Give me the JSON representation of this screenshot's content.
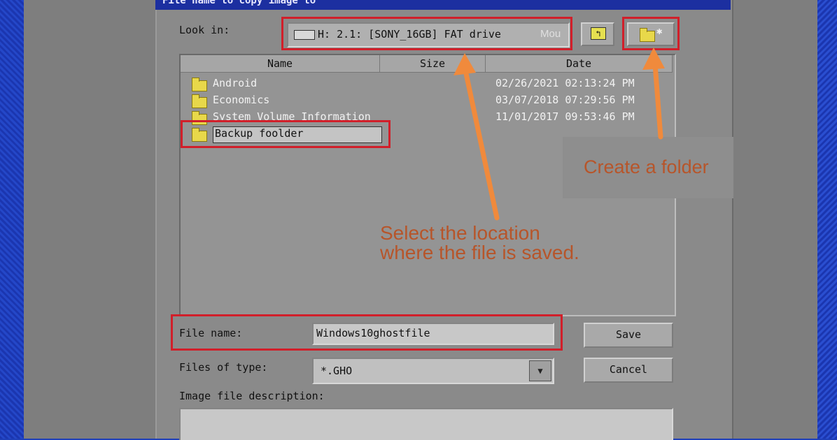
{
  "dialog": {
    "title": "File name to copy image to",
    "look_in_label": "Look in:",
    "look_in_value": "H: 2.1: [SONY_16GB] FAT drive",
    "look_in_fragment": "Mou",
    "columns": [
      "Name",
      "Size",
      "Date"
    ],
    "items": [
      {
        "name": "Android",
        "date": "02/26/2021 02:13:24 PM"
      },
      {
        "name": "Economics",
        "date": "03/07/2018 07:29:56 PM"
      },
      {
        "name": "System Volume Information",
        "date": "11/01/2017 09:53:46 PM"
      },
      {
        "name": "Backup foolder",
        "date": ""
      }
    ],
    "file_name_label": "File name:",
    "file_name_value": "Windows10ghostfile",
    "files_of_type_label": "Files of type:",
    "files_of_type_value": "*.GHO",
    "image_desc_label": "Image file description:",
    "save_button": "Save",
    "cancel_button": "Cancel"
  },
  "annotations": {
    "create_folder": "Create a folder",
    "select_location_line1": "Select the location",
    "select_location_line2": "where the file is saved."
  },
  "colors": {
    "highlight": "#d11f2a",
    "arrow": "#f08a3c",
    "callout_text": "#b7552a"
  }
}
